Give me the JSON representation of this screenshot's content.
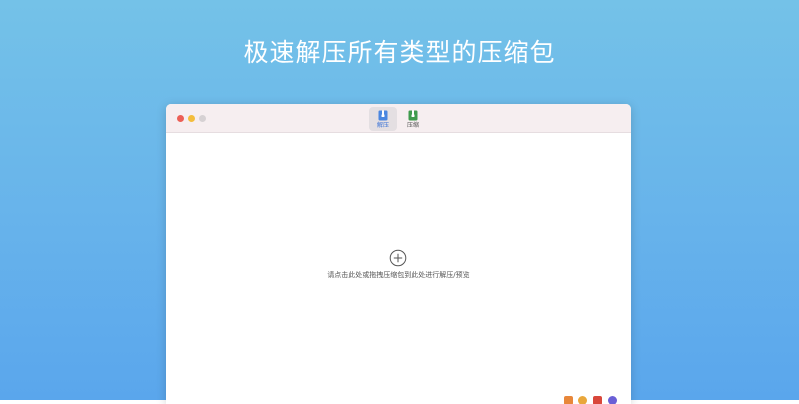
{
  "banner": {
    "headline": "极速解压所有类型的压缩包"
  },
  "window": {
    "tabs": [
      {
        "label": "解压",
        "icon": "extract-icon",
        "selected": true
      },
      {
        "label": "压缩",
        "icon": "compress-icon",
        "selected": false
      }
    ],
    "drop_zone": {
      "icon": "plus-circle-icon",
      "hint": "请点击此处或拖拽压缩包到此处进行解压/预览"
    }
  },
  "colors": {
    "backdrop_top": "#74c2e8",
    "backdrop_bottom": "#5aa6ec",
    "accent": "#3a72d6",
    "close": "#ec5f56",
    "minimize": "#f3bd3c",
    "maximize": "#d6d1d3"
  }
}
